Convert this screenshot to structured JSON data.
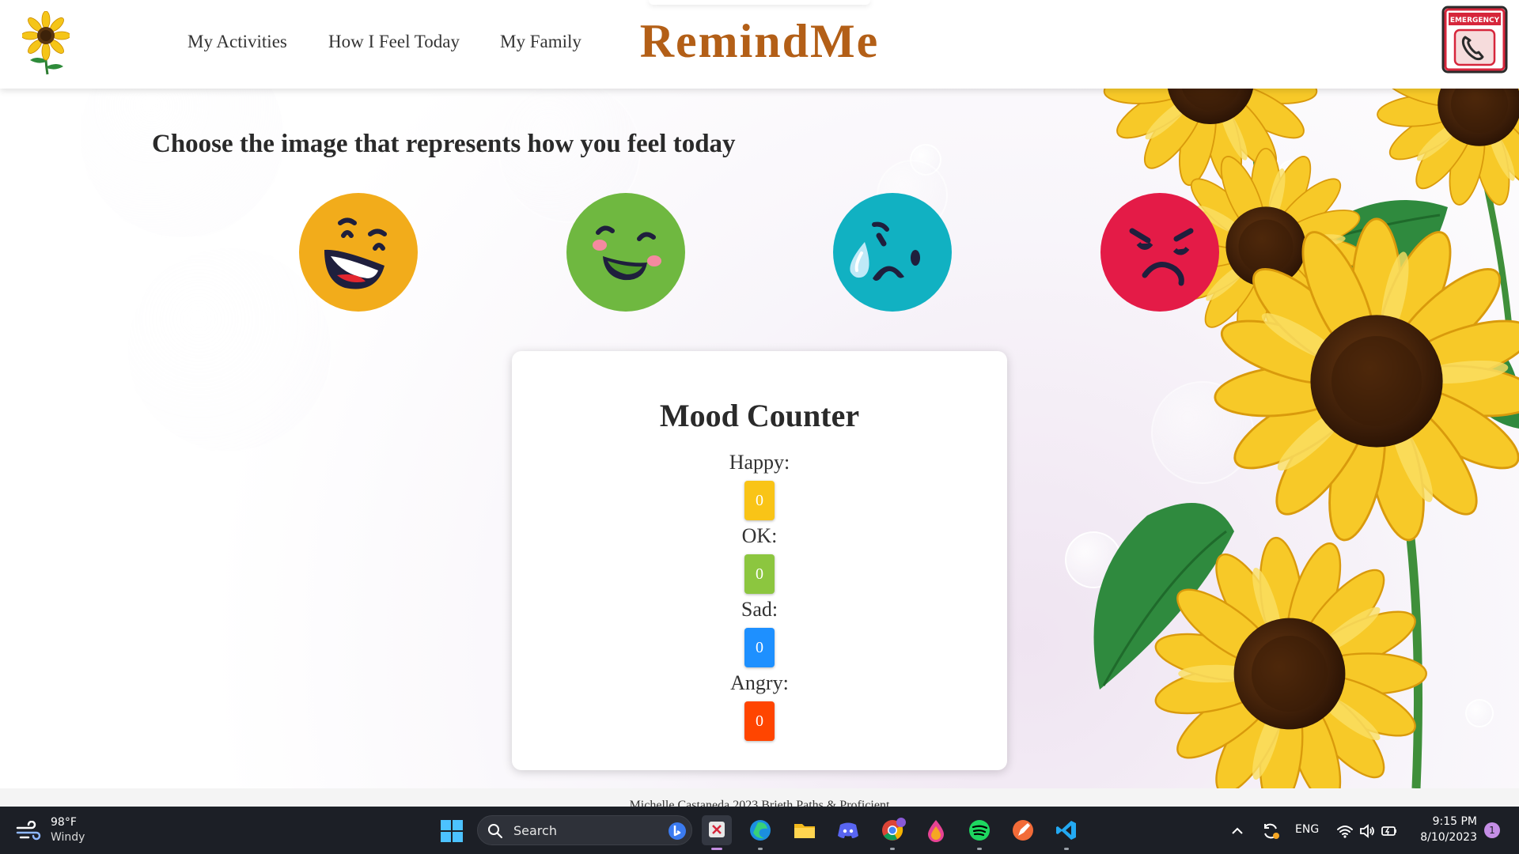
{
  "header": {
    "nav": [
      "My Activities",
      "How I Feel Today",
      "My Family"
    ],
    "brand": "RemindMe",
    "emergency_label": "EMERGENCY"
  },
  "main": {
    "heading": "Choose the image that represents how you feel today",
    "moods": [
      {
        "name": "happy",
        "color": "#F2AC1B"
      },
      {
        "name": "ok",
        "color": "#6FB840"
      },
      {
        "name": "sad",
        "color": "#11B1C2"
      },
      {
        "name": "angry",
        "color": "#E41B47"
      }
    ],
    "counter": {
      "title": "Mood Counter",
      "items": [
        {
          "label": "Happy:",
          "value": "0",
          "color": "#F9C417"
        },
        {
          "label": "OK:",
          "value": "0",
          "color": "#8CC63F"
        },
        {
          "label": "Sad:",
          "value": "0",
          "color": "#1E90FF"
        },
        {
          "label": "Angry:",
          "value": "0",
          "color": "#FF4500"
        }
      ]
    }
  },
  "footer": {
    "text": "Michelle Castaneda 2023 Brieth Paths & Proficient"
  },
  "taskbar": {
    "weather": {
      "temp": "98°F",
      "condition": "Windy",
      "icon": "wind-icon"
    },
    "search_placeholder": "Search",
    "apps": [
      "snipping-tool",
      "edge",
      "file-explorer",
      "discord",
      "chrome",
      "paint-drop",
      "spotify",
      "pen-app",
      "vscode"
    ],
    "tray": {
      "language": "ENG",
      "time": "9:15 PM",
      "date": "8/10/2023",
      "notifications": "1"
    }
  }
}
